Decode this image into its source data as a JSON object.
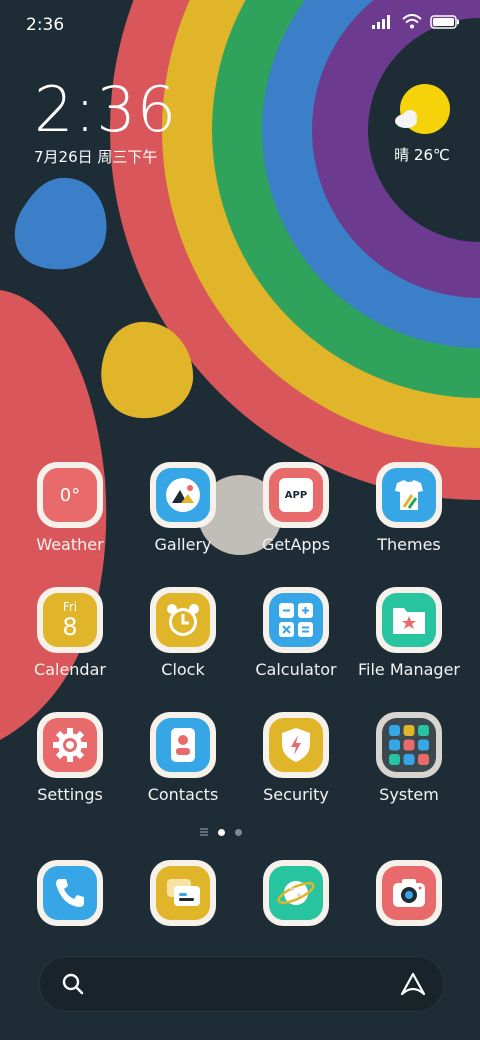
{
  "status_bar": {
    "time": "2:36"
  },
  "lockclock": {
    "time": "2:36",
    "date": "7月26日 周三下午"
  },
  "weather": {
    "text": "晴 26℃"
  },
  "apps": [
    {
      "name": "Weather",
      "icon": "weather-icon",
      "badge": "0°"
    },
    {
      "name": "Gallery",
      "icon": "gallery-icon"
    },
    {
      "name": "GetApps",
      "icon": "getapps-icon",
      "badge": "APP"
    },
    {
      "name": "Themes",
      "icon": "themes-icon"
    },
    {
      "name": "Calendar",
      "icon": "calendar-icon",
      "badge_day": "Fri",
      "badge_date": "8"
    },
    {
      "name": "Clock",
      "icon": "clock-icon"
    },
    {
      "name": "Calculator",
      "icon": "calculator-icon"
    },
    {
      "name": "File Manager",
      "icon": "file-manager-icon"
    },
    {
      "name": "Settings",
      "icon": "settings-icon"
    },
    {
      "name": "Contacts",
      "icon": "contacts-icon"
    },
    {
      "name": "Security",
      "icon": "security-icon"
    },
    {
      "name": "System",
      "icon": "system-folder-icon"
    }
  ],
  "dock": [
    "phone-icon",
    "messages-icon",
    "browser-icon",
    "camera-icon"
  ],
  "colors": {
    "background": "#1e2d35",
    "red": "#d9575a",
    "yellow": "#e1b52a",
    "green": "#2fa35c",
    "blue": "#3a7fc8",
    "purple": "#6c3b8f"
  }
}
